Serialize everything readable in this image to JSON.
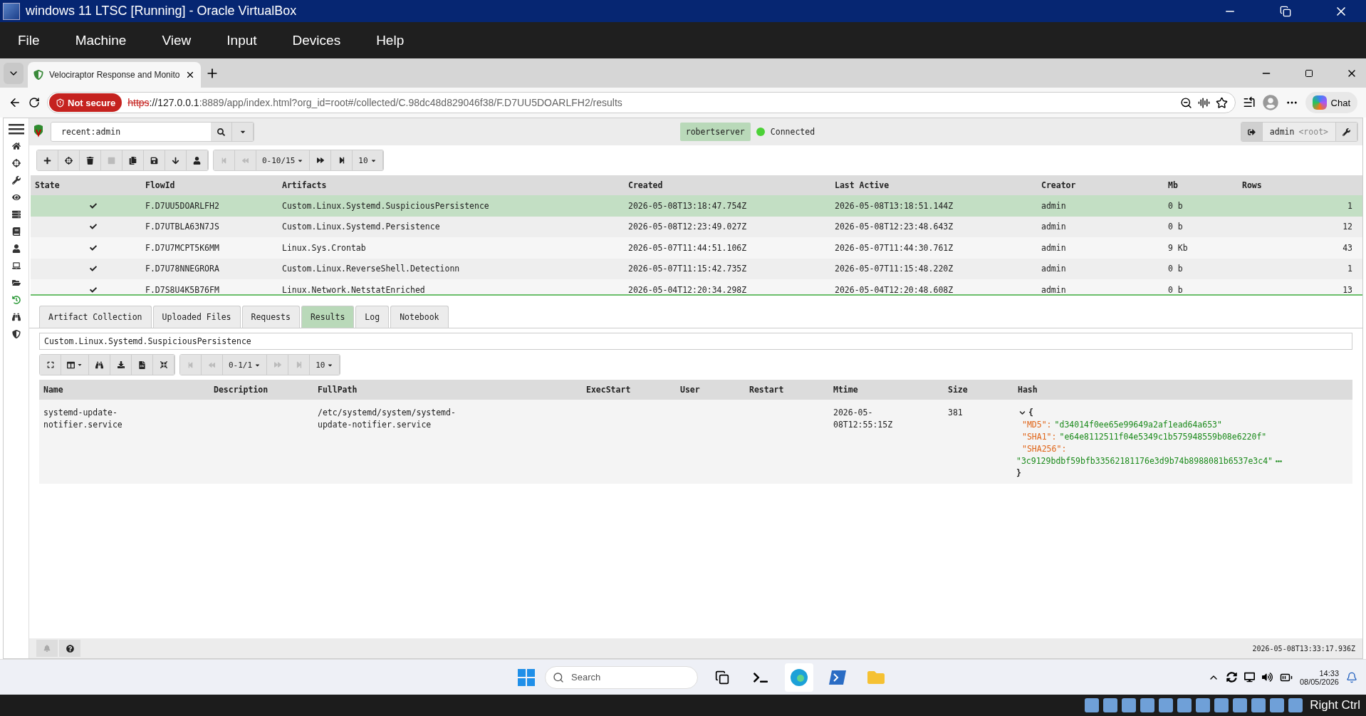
{
  "vm_window": {
    "title": "windows 11 LTSC [Running] - Oracle VirtualBox"
  },
  "vm_menu": [
    "File",
    "Machine",
    "View",
    "Input",
    "Devices",
    "Help"
  ],
  "browser": {
    "tab": {
      "title": "Velociraptor Response and Monito",
      "selected": true
    },
    "address": {
      "security": "Not secure",
      "scheme": "https",
      "host": "://127.0.0.1",
      "rest": ":8889/app/index.html?org_id=root#/collected/C.98dc48d829046f38/F.D7UU5DOARLFH2/results"
    },
    "chat_label": "Chat"
  },
  "app": {
    "search": {
      "value": "recent:admin"
    },
    "server": "robertserver",
    "status": {
      "label": "Connected",
      "online": true
    },
    "user": {
      "name": "admin",
      "org": "<root>"
    },
    "sidebar_items": [
      {
        "selected": false
      },
      {
        "selected": false
      },
      {
        "selected": false
      },
      {
        "selected": false
      },
      {
        "selected": false
      },
      {
        "selected": false
      },
      {
        "selected": false
      },
      {
        "selected": false
      },
      {
        "selected": false
      },
      {
        "selected": true
      },
      {
        "selected": false
      },
      {
        "selected": false
      }
    ],
    "flow_toolbar": {
      "buttons": [
        {
          "disabled": false
        },
        {
          "disabled": false
        },
        {
          "disabled": false
        },
        {
          "disabled": true
        },
        {
          "disabled": false
        },
        {
          "disabled": false
        },
        {
          "disabled": false
        },
        {
          "disabled": false
        }
      ],
      "first_disabled": true,
      "prev_disabled": true,
      "page": "0-10/15",
      "page_size": "10"
    },
    "flows": {
      "columns": [
        "State",
        "FlowId",
        "Artifacts",
        "Created",
        "Last Active",
        "Creator",
        "Mb",
        "Rows"
      ],
      "rows": [
        {
          "done": true,
          "selected": true,
          "flow_id": "F.D7UU5DOARLFH2",
          "artifact": "Custom.Linux.Systemd.SuspiciousPersistence",
          "created": "2026-05-08T13:18:47.754Z",
          "last_active": "2026-05-08T13:18:51.144Z",
          "creator": "admin",
          "mb": "0 b",
          "rows": "1"
        },
        {
          "done": true,
          "selected": false,
          "flow_id": "F.D7UTBLA63N7JS",
          "artifact": "Custom.Linux.Systemd.Persistence",
          "created": "2026-05-08T12:23:49.027Z",
          "last_active": "2026-05-08T12:23:48.643Z",
          "creator": "admin",
          "mb": "0 b",
          "rows": "12"
        },
        {
          "done": true,
          "selected": false,
          "flow_id": "F.D7U7MCPT5K6MM",
          "artifact": "Linux.Sys.Crontab",
          "created": "2026-05-07T11:44:51.106Z",
          "last_active": "2026-05-07T11:44:30.761Z",
          "creator": "admin",
          "mb": "9 Kb",
          "rows": "43"
        },
        {
          "done": true,
          "selected": false,
          "flow_id": "F.D7U78NNEGRORA",
          "artifact": "Custom.Linux.ReverseShell.Detectionn",
          "created": "2026-05-07T11:15:42.735Z",
          "last_active": "2026-05-07T11:15:48.220Z",
          "creator": "admin",
          "mb": "0 b",
          "rows": "1"
        },
        {
          "done": true,
          "selected": false,
          "flow_id": "F.D7S8U4K5B76FM",
          "artifact": "Linux.Network.NetstatEnriched",
          "created": "2026-05-04T12:20:34.298Z",
          "last_active": "2026-05-04T12:20:48.608Z",
          "creator": "admin",
          "mb": "0 b",
          "rows": "13"
        }
      ]
    },
    "detail_tabs": [
      {
        "label": "Artifact Collection",
        "selected": false
      },
      {
        "label": "Uploaded Files",
        "selected": false
      },
      {
        "label": "Requests",
        "selected": false
      },
      {
        "label": "Results",
        "selected": true
      },
      {
        "label": "Log",
        "selected": false
      },
      {
        "label": "Notebook",
        "selected": false
      }
    ],
    "artifact_name": "Custom.Linux.Systemd.SuspiciousPersistence",
    "result_toolbar": {
      "page": "0-1/1",
      "page_size": "10"
    },
    "results": {
      "columns": [
        "Name",
        "Description",
        "FullPath",
        "ExecStart",
        "User",
        "Restart",
        "Mtime",
        "Size",
        "Hash"
      ],
      "rows": [
        {
          "name": "systemd-update-notifier.service",
          "full_path": "/etc/systemd/system/systemd-update-notifier.service",
          "mtime": "2026-05-08T12:55:15Z",
          "size": "381",
          "hash": {
            "expanded": true,
            "open": "{",
            "close": "}",
            "entries": [
              {
                "key": "\"MD5\":",
                "value": "\"d34014f0ee65e99649a2af1ead64a653\""
              },
              {
                "key": "\"SHA1\":",
                "value": "\"e64e8112511f04e5349c1b575948559b08e6220f\""
              },
              {
                "key": "\"SHA256\":",
                "value": "\"3c9129bdbf59bfb33562181176e3d9b74b8988081b6537e3c4\"",
                "wrapped": true
              }
            ]
          }
        }
      ]
    },
    "footer_time": "2026-05-08T13:33:17.936Z"
  },
  "taskbar": {
    "search_placeholder": "Search",
    "time": "14:33",
    "date": "08/05/2026"
  },
  "vm_status": {
    "host_key": "Right Ctrl"
  }
}
